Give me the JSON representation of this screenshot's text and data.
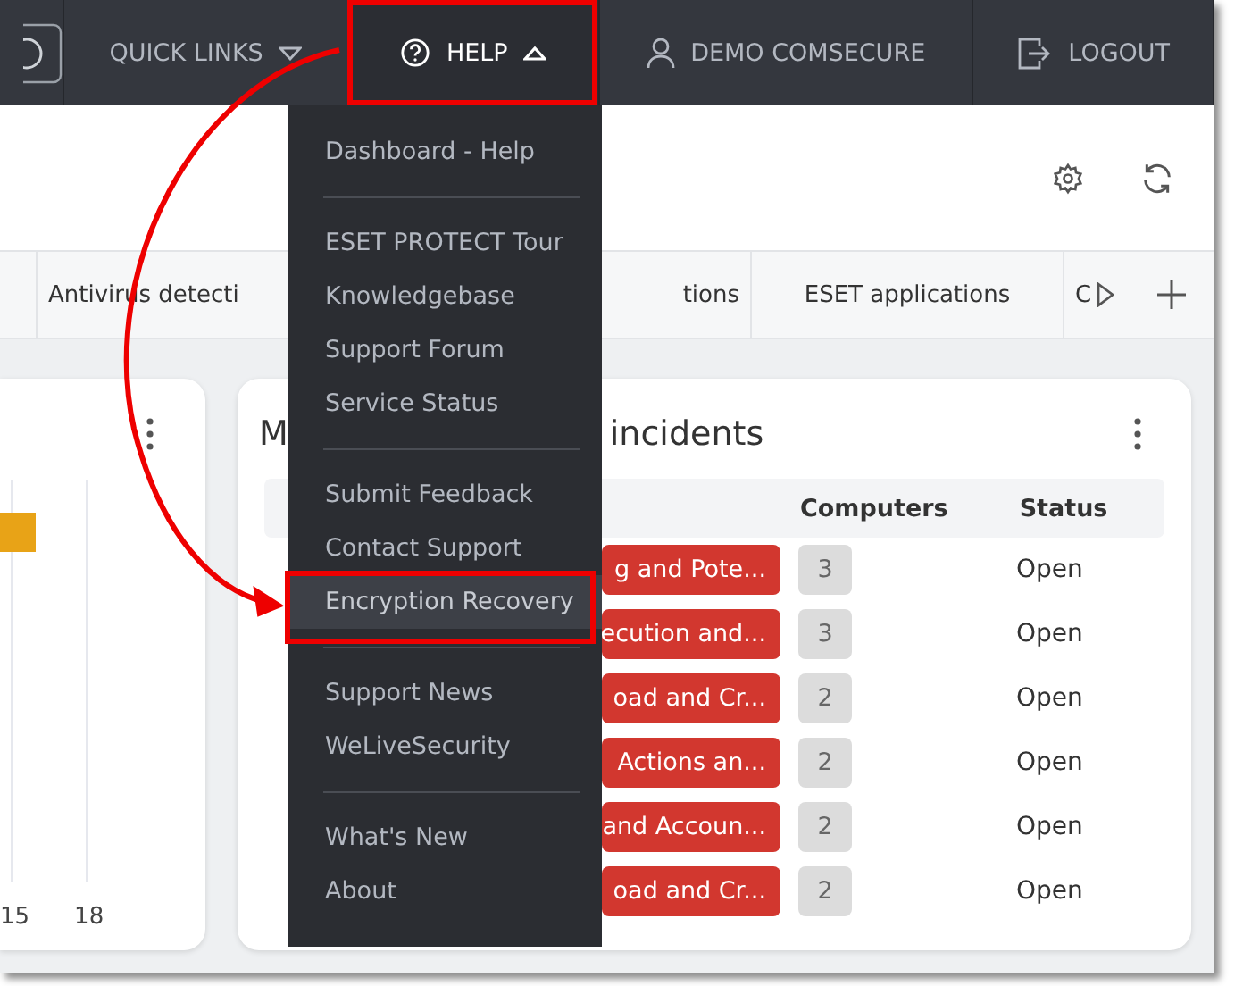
{
  "top_bar": {
    "items": [
      {
        "kind": "link",
        "label": "QUICK LINKS",
        "expanded": false
      },
      {
        "kind": "help",
        "label": "HELP",
        "expanded": true
      },
      {
        "kind": "user",
        "label": "DEMO COMSECURE",
        "expanded": false
      },
      {
        "kind": "logout",
        "label": "LOGOUT",
        "expanded": false
      }
    ]
  },
  "tabs": [
    {
      "label": "Antivirus detecti"
    },
    {
      "label": "tions"
    },
    {
      "label": "ESET applications"
    },
    {
      "label": "C"
    }
  ],
  "chart_card": {
    "x_labels": [
      "15",
      "18"
    ]
  },
  "incidents_card": {
    "title_start": "M",
    "title_end": "incidents",
    "columns": [
      "Computers",
      "Status"
    ],
    "rows": [
      {
        "name": "g and Pote...",
        "computers": "3",
        "status": "Open"
      },
      {
        "name": "ecution and...",
        "computers": "3",
        "status": "Open"
      },
      {
        "name": "oad and Cr...",
        "computers": "2",
        "status": "Open"
      },
      {
        "name": "Actions an...",
        "computers": "2",
        "status": "Open"
      },
      {
        "name": "and Accoun...",
        "computers": "2",
        "status": "Open"
      },
      {
        "name": "oad and Cr...",
        "computers": "2",
        "status": "Open"
      }
    ]
  },
  "help_menu": {
    "groups": [
      [
        {
          "label": "Dashboard - Help",
          "selected": false
        }
      ],
      [
        {
          "label": "ESET PROTECT Tour",
          "selected": false
        },
        {
          "label": "Knowledgebase",
          "selected": false
        },
        {
          "label": "Support Forum",
          "selected": false
        },
        {
          "label": "Service Status",
          "selected": false
        }
      ],
      [
        {
          "label": "Submit Feedback",
          "selected": false
        },
        {
          "label": "Contact Support",
          "selected": false
        },
        {
          "label": "Encryption Recovery",
          "selected": true
        }
      ],
      [
        {
          "label": "Support News",
          "selected": false
        },
        {
          "label": "WeLiveSecurity",
          "selected": false
        }
      ],
      [
        {
          "label": "What's New",
          "selected": false
        },
        {
          "label": "About",
          "selected": false
        }
      ]
    ]
  }
}
